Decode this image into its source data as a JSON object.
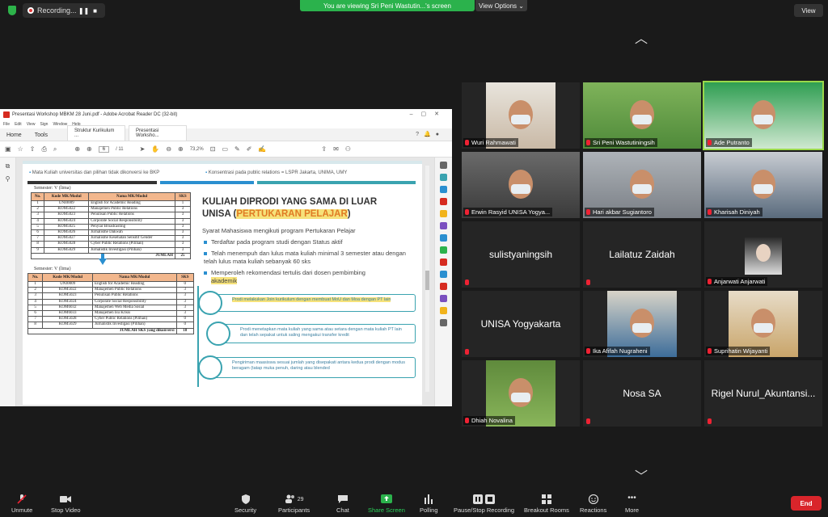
{
  "recording": {
    "label": "Recording...",
    "pause_icon": "pause-icon",
    "stop_icon": "stop-icon"
  },
  "banner": {
    "text": "You are viewing Sri Peni Wastutin...'s screen",
    "view_options": "View Options ⌄"
  },
  "view_button": "View",
  "acrobat": {
    "window_title": "Presentasi Workshop MBKM 28 Juni.pdf - Adobe Acrobat Reader DC (32-bit)",
    "menu": [
      "File",
      "Edit",
      "View",
      "Sign",
      "Window",
      "Help"
    ],
    "tabs": [
      "Home",
      "Tools"
    ],
    "doc_tabs": [
      "Struktur Kurikulum ...",
      "Presentasi Worksho..."
    ],
    "page_current": "6",
    "page_total": "/ 11",
    "zoom": "73,2%"
  },
  "slide": {
    "header_left": "Mata Kuliah universitas dan pilihan tidak dikonversi ke BKP",
    "header_right": "Konsentrasi pada public relations = LSPR Jakarta, UNIMA, UMY",
    "semester1": "Semester: V (lima)",
    "table1_headers": [
      "No.",
      "Kode MK/Modul",
      "Nama MK/Modul",
      "SKS"
    ],
    "table1_rows": [
      [
        "1",
        "UNI0009",
        "English for Academic Reading",
        "1"
      ],
      [
        "2",
        "KOM5022",
        "Manajemen Public Relations",
        "3"
      ],
      [
        "3",
        "KOM5023",
        "Penulisan Public Relations",
        "3"
      ],
      [
        "4",
        "KOM5024",
        "Corporate Social Responsibility",
        "3"
      ],
      [
        "5",
        "KOM5025",
        "Penyiar Broadcasting",
        "3"
      ],
      [
        "6",
        "KOM5026",
        "Jurnalisme Dakwah",
        "3"
      ],
      [
        "7",
        "KOM5027",
        "Jurnalisme Kesehatan Sensitif Gender",
        "3"
      ],
      [
        "8",
        "KOM5028",
        "Cyber Public Relations (Pilihan)",
        "3"
      ],
      [
        "9",
        "KOM5029",
        "Jurnalistik Investigasi (Pilihan)",
        "3"
      ]
    ],
    "table1_total_label": "JUMLAH",
    "table1_total": "25",
    "semester2": "Semester: V (lima)",
    "table2_headers": [
      "No.",
      "Kode MK/Modul",
      "Nama MK/Modul",
      "SKS"
    ],
    "table2_rows": [
      [
        "1",
        "UNI0009",
        "English for Academic Reading",
        "0"
      ],
      [
        "2",
        "KOM5022",
        "Manajemen Public Relations",
        "3"
      ],
      [
        "3",
        "KOM5023",
        "Penulisan Public Relations",
        "3"
      ],
      [
        "4",
        "KOM5024",
        "Corporate Social Responsibility",
        "3"
      ],
      [
        "5",
        "KOM6032",
        "Manajemen Web Media Sosial",
        "3"
      ],
      [
        "6",
        "KOM6033",
        "Manajemen Isu Krisis",
        "3"
      ],
      [
        "7",
        "KOM5028",
        "Cyber Public Relations (Pilihan)",
        "0"
      ],
      [
        "8",
        "KOM5029",
        "Jurnalistik Investigasi (Pilihan)",
        "0"
      ]
    ],
    "table2_total_label": "JUMLAH SKS yang dikonversi",
    "table2_total": "18",
    "title_line1": "KULIAH DIPRODI YANG SAMA DI LUAR",
    "title_line2a": "UNISA (",
    "title_line2b": "PERTUKARAN PELAJAR",
    "title_line2c": ")",
    "syarat": "Syarat Mahasiswa mengikuti program Pertukaran Pelajar",
    "bullet1": "Terdaftar pada program studi dengan Status aktif",
    "bullet2": "Telah menempuh dan lulus mata kuliah minimal 3 semester atau dengan telah lulus mata kuliah sebanyak 60 sks",
    "bullet3a": "Memperoleh rekomendasi tertulis dari dosen pembimbing",
    "bullet3b": "akademik",
    "step1": "Prodi melakukan Join kurikulum dengan membuat MoU dan Moa dengan PT lain",
    "step2": "Prodi menetapkan mata kuliah yang sama atau setara dengan mata kuliah PT lain dan telah sepakat untuk saling mengakui transfer kredit",
    "step3": "Pengiriman maasiswa sesuai jumlah yang disepakati antara kedua prodi dengan modus beragam (tatap muka penuh, daring atau blended"
  },
  "participants_grid": [
    {
      "name": "Wuri Rahmawati",
      "video": true,
      "muted": true
    },
    {
      "name": "Sri Peni Wastutiningsih",
      "video": true,
      "muted": true
    },
    {
      "name": "Ade Putranto",
      "video": true,
      "muted": true
    },
    {
      "name": "Erwin Rasyid UNISA Yogya...",
      "video": true,
      "muted": true
    },
    {
      "name": "Hari akbar Sugiantoro",
      "video": true,
      "muted": true
    },
    {
      "name": "Kharisah Diniyah",
      "video": true,
      "muted": true
    },
    {
      "name": "sulistyaningsih",
      "video": false,
      "muted": true
    },
    {
      "name": "Lailatuz Zaidah",
      "video": false,
      "muted": true
    },
    {
      "name": "Anjarwati Anjarwati",
      "video": false,
      "muted": true
    },
    {
      "name": "UNISA Yogyakarta",
      "video": false,
      "muted": true
    },
    {
      "name": "Ika Afifah Nugraheni",
      "video": true,
      "muted": true
    },
    {
      "name": "Suprihatin Wijayanti",
      "video": true,
      "muted": true
    },
    {
      "name": "Dhiah Novalina",
      "video": true,
      "muted": true
    },
    {
      "name": "Nosa SA",
      "video": false,
      "muted": true
    },
    {
      "name": "Rigel Nurul_Akuntansi...",
      "video": false,
      "muted": true
    }
  ],
  "toolbar": {
    "unmute": "Unmute",
    "stop_video": "Stop Video",
    "security": "Security",
    "participants": "Participants",
    "participants_count": "29",
    "chat": "Chat",
    "share_screen": "Share Screen",
    "polling": "Polling",
    "pause_recording": "Pause/Stop Recording",
    "breakout": "Breakout Rooms",
    "reactions": "Reactions",
    "more": "More",
    "end": "End"
  },
  "colors": {
    "accent_green": "#2bb24c",
    "end_red": "#d9252b",
    "slide_teal": "#3aa3b0",
    "table_orange": "#f2b78d",
    "highlight_yellow": "#f6e27a"
  }
}
